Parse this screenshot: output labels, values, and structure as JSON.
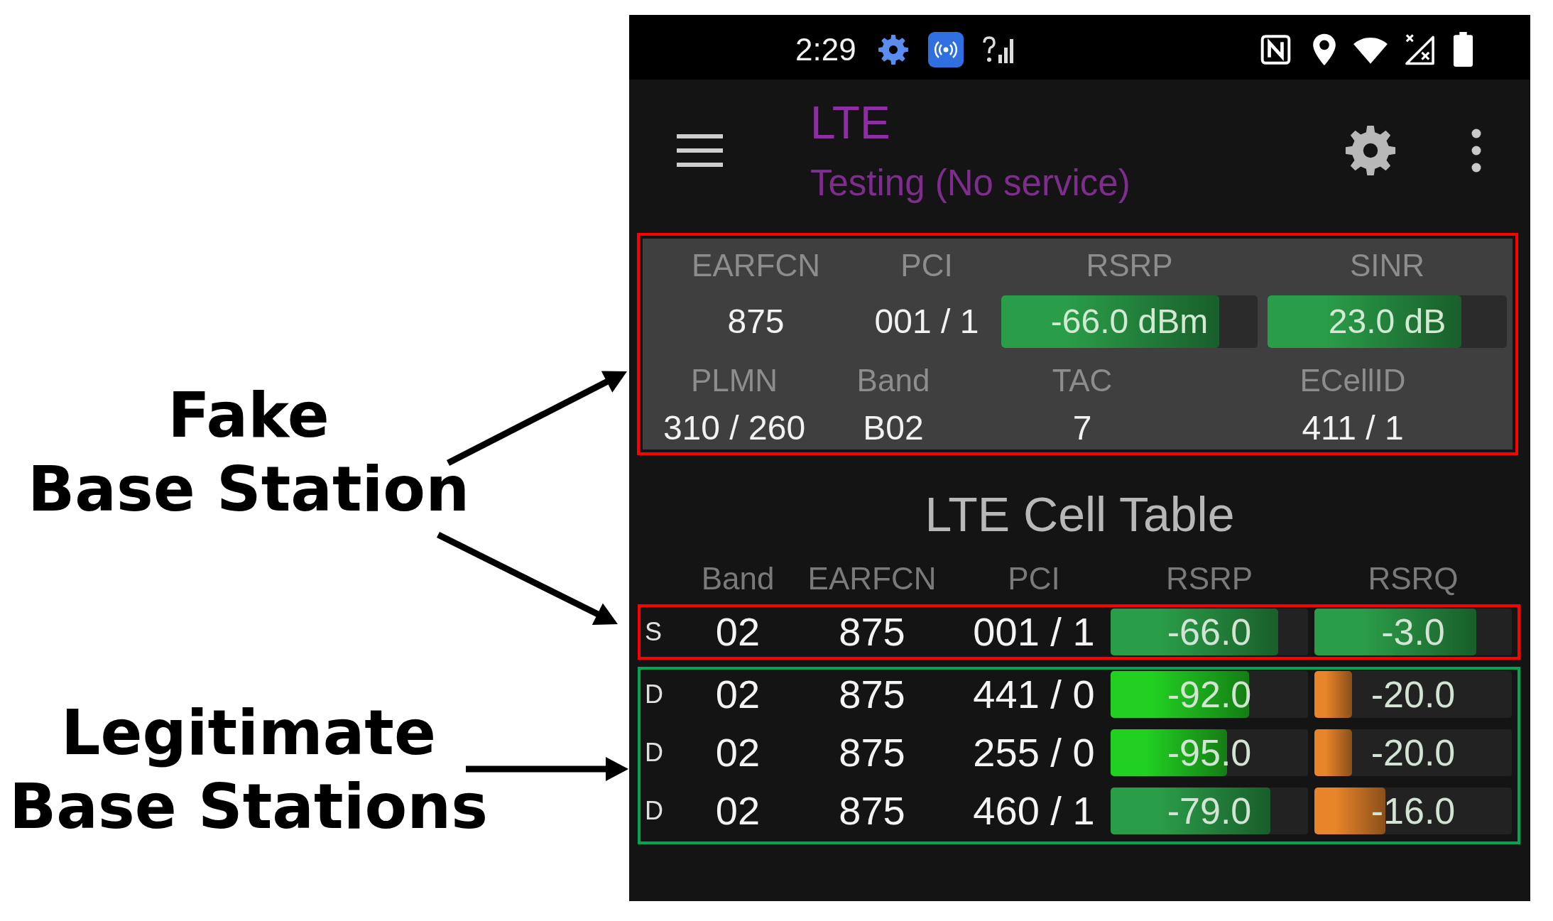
{
  "callouts": [
    {
      "text": "Fake\nBase Station"
    },
    {
      "text": "Legitimate\nBase Stations"
    }
  ],
  "status_bar": {
    "time": "2:29"
  },
  "app_bar": {
    "title": "LTE",
    "subtitle": "Testing (No service)"
  },
  "serving_cell": {
    "rows": [
      {
        "fields": [
          {
            "kind": "text",
            "label": "EARFCN",
            "value": "875"
          },
          {
            "kind": "text",
            "label": "PCI",
            "value": "001 / 1"
          },
          {
            "kind": "meter",
            "label": "RSRP",
            "value": "-66.0 dBm",
            "level": 0.85,
            "color": "#2a9d48"
          },
          {
            "kind": "meter",
            "label": "SINR",
            "value": "23.0 dB",
            "level": 0.81,
            "color": "#2a9d48"
          }
        ]
      },
      {
        "fields": [
          {
            "kind": "text",
            "label": "PLMN",
            "value": "310 / 260"
          },
          {
            "kind": "text",
            "label": "Band",
            "value": "B02"
          },
          {
            "kind": "text",
            "label": "TAC",
            "value": "7"
          },
          {
            "kind": "text",
            "label": "ECellID",
            "value": "411 / 1"
          }
        ]
      }
    ]
  },
  "cell_table": {
    "title": "LTE Cell Table",
    "columns": [
      "Band",
      "EARFCN",
      "PCI",
      "RSRP",
      "RSRQ"
    ],
    "row_groups": [
      {
        "color": "#ff0000",
        "rows": [
          {
            "marker": "S",
            "band": "02",
            "earfcn": "875",
            "pci": "001 / 1",
            "rsrp": {
              "value": "-66.0",
              "level": 0.85,
              "color": "#2a9d48"
            },
            "rsrq": {
              "value": "-3.0",
              "level": 0.82,
              "color": "#2a9d48"
            }
          }
        ]
      },
      {
        "color": "#00a651",
        "rows": [
          {
            "marker": "D",
            "band": "02",
            "earfcn": "875",
            "pci": "441 / 0",
            "rsrp": {
              "value": "-92.0",
              "level": 0.7,
              "color": "#22d022"
            },
            "rsrq": {
              "value": "-20.0",
              "level": 0.19,
              "color": "#e8842a"
            }
          },
          {
            "marker": "D",
            "band": "02",
            "earfcn": "875",
            "pci": "255 / 0",
            "rsrp": {
              "value": "-95.0",
              "level": 0.59,
              "color": "#22d022"
            },
            "rsrq": {
              "value": "-20.0",
              "level": 0.19,
              "color": "#e8842a"
            }
          },
          {
            "marker": "D",
            "band": "02",
            "earfcn": "875",
            "pci": "460 / 1",
            "rsrp": {
              "value": "-79.0",
              "level": 0.81,
              "color": "#2a9d48"
            },
            "rsrq": {
              "value": "-16.0",
              "level": 0.36,
              "color": "#e8842a"
            }
          }
        ]
      }
    ]
  }
}
